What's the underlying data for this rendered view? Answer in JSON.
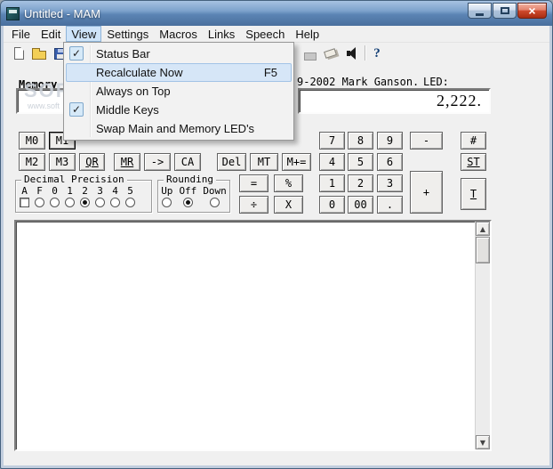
{
  "window": {
    "title": "Untitled - MAM"
  },
  "menubar": {
    "items": [
      "File",
      "Edit",
      "View",
      "Settings",
      "Macros",
      "Links",
      "Speech",
      "Help"
    ]
  },
  "view_menu": {
    "items": [
      {
        "label": "Status Bar",
        "checked": true,
        "shortcut": ""
      },
      {
        "label": "Recalculate Now",
        "checked": false,
        "shortcut": "F5"
      },
      {
        "label": "Always on Top",
        "checked": false,
        "shortcut": ""
      },
      {
        "label": "Middle Keys",
        "checked": true,
        "shortcut": ""
      },
      {
        "label": "Swap Main and Memory LED's",
        "checked": false,
        "shortcut": ""
      }
    ]
  },
  "header": {
    "memory_label": "Memory",
    "copyright_fragment": "9-2002 Mark Ganson.",
    "led_label": "LED:",
    "memory_display": "",
    "main_display": "2,222."
  },
  "watermark": {
    "line1": "SOFT",
    "line2": "www.soft"
  },
  "keys": {
    "memory": [
      "M0",
      "M1",
      "M2",
      "M3",
      "QR",
      "MR",
      "->",
      "CA",
      "Del",
      "MT",
      "M+="
    ],
    "numpad": [
      "7",
      "8",
      "9",
      "4",
      "5",
      "6",
      "1",
      "2",
      "3",
      "0",
      "00",
      "."
    ],
    "operators": {
      "minus": "-",
      "hash": "#",
      "st": "ST",
      "plus": "+",
      "t": "T",
      "equals": "=",
      "percent": "%",
      "divide": "÷",
      "multiply": "X"
    }
  },
  "decimal_precision": {
    "title": "Decimal Precision",
    "options": [
      "A",
      "F",
      "0",
      "1",
      "2",
      "3",
      "4",
      "5"
    ],
    "selected": "2"
  },
  "rounding": {
    "title": "Rounding",
    "options": [
      "Up",
      "Off",
      "Down"
    ],
    "selected": "Off"
  },
  "icons": {
    "check": "✓",
    "scroll_up": "▲",
    "scroll_down": "▼",
    "help": "?",
    "close": "×"
  },
  "colors": {
    "titlebar_blue": "#5b84b4",
    "close_red": "#cf4b2e",
    "menu_highlight": "#d6e6f7",
    "display_bg": "#ffffff"
  }
}
